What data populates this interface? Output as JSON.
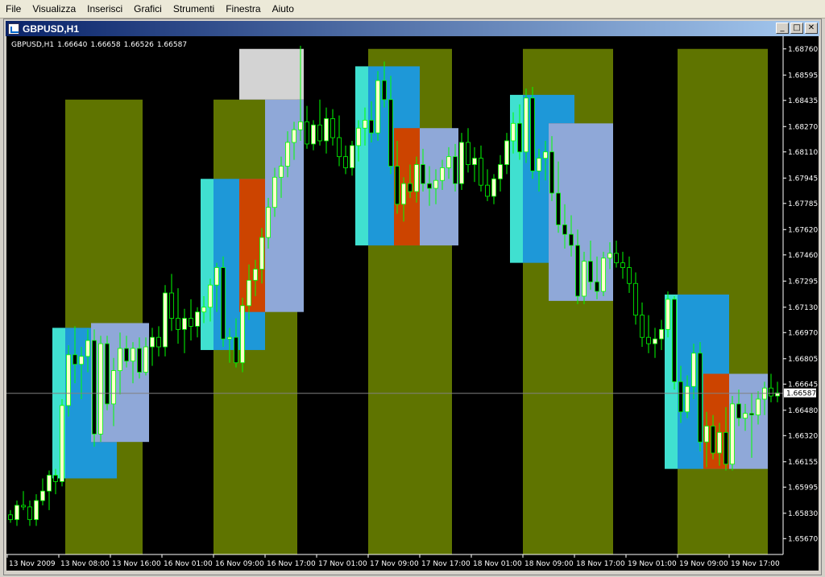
{
  "menu": {
    "items": [
      "File",
      "Visualizza",
      "Inserisci",
      "Grafici",
      "Strumenti",
      "Finestra",
      "Aiuto"
    ]
  },
  "window": {
    "title": "GBPUSD,H1",
    "buttons": {
      "minimize": "_",
      "maximize": "□",
      "close": "✕"
    }
  },
  "chart_info": {
    "symbol": "GBPUSD,H1",
    "open": "1.66640",
    "high": "1.66658",
    "low": "1.66526",
    "close": "1.66587"
  },
  "colors": {
    "background": "#000000",
    "axis_text": "#ffffff",
    "bull_body": "#ffffcc",
    "bear_body": "#000000",
    "candle_outline": "#00ff00",
    "session_band": "#5f7400",
    "zone_cyan": "#40e0d0",
    "zone_blue": "#1e98d8",
    "zone_orange": "#cc4400",
    "zone_light": "#8fa8d8",
    "zone_gray": "#d3d3d3",
    "price_line": "#808080"
  },
  "chart_data": {
    "type": "candlestick",
    "symbol": "GBPUSD",
    "timeframe": "H1",
    "ylim": [
      1.6557,
      1.6884
    ],
    "current_price": "1.66587",
    "y_ticks": [
      "1.68760",
      "1.68595",
      "1.68435",
      "1.68270",
      "1.68110",
      "1.67945",
      "1.67785",
      "1.67620",
      "1.67460",
      "1.67295",
      "1.67130",
      "1.66970",
      "1.66805",
      "1.66645",
      "1.66480",
      "1.66320",
      "1.66155",
      "1.65995",
      "1.65830",
      "1.65670"
    ],
    "x_ticks": [
      {
        "label": "13 Nov 2009",
        "bar": 0
      },
      {
        "label": "13 Nov 08:00",
        "bar": 8
      },
      {
        "label": "13 Nov 16:00",
        "bar": 16
      },
      {
        "label": "16 Nov 01:00",
        "bar": 24
      },
      {
        "label": "16 Nov 09:00",
        "bar": 32
      },
      {
        "label": "16 Nov 17:00",
        "bar": 40
      },
      {
        "label": "17 Nov 01:00",
        "bar": 48
      },
      {
        "label": "17 Nov 09:00",
        "bar": 56
      },
      {
        "label": "17 Nov 17:00",
        "bar": 64
      },
      {
        "label": "18 Nov 01:00",
        "bar": 72
      },
      {
        "label": "18 Nov 09:00",
        "bar": 80
      },
      {
        "label": "18 Nov 17:00",
        "bar": 88
      },
      {
        "label": "19 Nov 01:00",
        "bar": 96
      },
      {
        "label": "19 Nov 09:00",
        "bar": 104
      },
      {
        "label": "19 Nov 17:00",
        "bar": 112
      }
    ],
    "session_bands": [
      {
        "start": 9,
        "end": 21,
        "low": 1.6557,
        "high": 1.6844
      },
      {
        "start": 32,
        "end": 45,
        "low": 1.6557,
        "high": 1.6844
      },
      {
        "start": 56,
        "end": 69,
        "low": 1.6557,
        "high": 1.6876
      },
      {
        "start": 80,
        "end": 94,
        "low": 1.6557,
        "high": 1.6876
      },
      {
        "start": 104,
        "end": 118,
        "low": 1.6557,
        "high": 1.6876
      }
    ],
    "zones": [
      {
        "start": 7,
        "end": 9,
        "low": 1.6605,
        "high": 1.67,
        "color": "zone_cyan"
      },
      {
        "start": 9,
        "end": 17,
        "low": 1.6605,
        "high": 1.67,
        "color": "zone_blue"
      },
      {
        "start": 13,
        "end": 17,
        "low": 1.6628,
        "high": 1.67,
        "color": "zone_orange"
      },
      {
        "start": 13,
        "end": 22,
        "low": 1.6628,
        "high": 1.6703,
        "color": "zone_light"
      },
      {
        "start": 30,
        "end": 32,
        "low": 1.6686,
        "high": 1.6794,
        "color": "zone_cyan"
      },
      {
        "start": 32,
        "end": 40,
        "low": 1.6686,
        "high": 1.6794,
        "color": "zone_blue"
      },
      {
        "start": 36,
        "end": 40,
        "low": 1.671,
        "high": 1.6794,
        "color": "zone_orange"
      },
      {
        "start": 40,
        "end": 46,
        "low": 1.671,
        "high": 1.6844,
        "color": "zone_light"
      },
      {
        "start": 36,
        "end": 46,
        "low": 1.6844,
        "high": 1.6876,
        "color": "zone_gray"
      },
      {
        "start": 54,
        "end": 56,
        "low": 1.6752,
        "high": 1.6865,
        "color": "zone_cyan"
      },
      {
        "start": 56,
        "end": 64,
        "low": 1.6752,
        "high": 1.6865,
        "color": "zone_blue"
      },
      {
        "start": 60,
        "end": 64,
        "low": 1.6752,
        "high": 1.6826,
        "color": "zone_orange"
      },
      {
        "start": 64,
        "end": 70,
        "low": 1.6752,
        "high": 1.6826,
        "color": "zone_light"
      },
      {
        "start": 78,
        "end": 80,
        "low": 1.6741,
        "high": 1.6847,
        "color": "zone_cyan"
      },
      {
        "start": 80,
        "end": 88,
        "low": 1.6741,
        "high": 1.6847,
        "color": "zone_blue"
      },
      {
        "start": 84,
        "end": 88,
        "low": 1.6741,
        "high": 1.6829,
        "color": "zone_orange"
      },
      {
        "start": 84,
        "end": 94,
        "low": 1.6717,
        "high": 1.6829,
        "color": "zone_light"
      },
      {
        "start": 102,
        "end": 104,
        "low": 1.6611,
        "high": 1.6721,
        "color": "zone_cyan"
      },
      {
        "start": 104,
        "end": 112,
        "low": 1.6611,
        "high": 1.6721,
        "color": "zone_blue"
      },
      {
        "start": 108,
        "end": 112,
        "low": 1.6611,
        "high": 1.6671,
        "color": "zone_orange"
      },
      {
        "start": 112,
        "end": 118,
        "low": 1.6611,
        "high": 1.6671,
        "color": "zone_light"
      }
    ],
    "candles": [
      [
        1.6582,
        1.6585,
        1.6577,
        1.6579
      ],
      [
        1.6579,
        1.6591,
        1.6575,
        1.6588
      ],
      [
        1.6588,
        1.6597,
        1.6585,
        1.6587
      ],
      [
        1.6587,
        1.6591,
        1.6575,
        1.6579
      ],
      [
        1.6579,
        1.6595,
        1.6575,
        1.6591
      ],
      [
        1.6591,
        1.6605,
        1.6588,
        1.6597
      ],
      [
        1.6597,
        1.661,
        1.6585,
        1.6607
      ],
      [
        1.6607,
        1.6611,
        1.6595,
        1.6603
      ],
      [
        1.6603,
        1.6655,
        1.66,
        1.6651
      ],
      [
        1.6651,
        1.6689,
        1.6644,
        1.6683
      ],
      [
        1.6683,
        1.6701,
        1.6665,
        1.6677
      ],
      [
        1.6677,
        1.6688,
        1.6655,
        1.6682
      ],
      [
        1.6682,
        1.6699,
        1.6672,
        1.6692
      ],
      [
        1.6692,
        1.6699,
        1.6625,
        1.6633
      ],
      [
        1.6633,
        1.6695,
        1.6628,
        1.669
      ],
      [
        1.669,
        1.6695,
        1.6648,
        1.6652
      ],
      [
        1.6652,
        1.6681,
        1.6638,
        1.6673
      ],
      [
        1.6673,
        1.6697,
        1.6658,
        1.6687
      ],
      [
        1.6687,
        1.6695,
        1.6675,
        1.6679
      ],
      [
        1.6679,
        1.6691,
        1.6665,
        1.6687
      ],
      [
        1.6687,
        1.6694,
        1.6668,
        1.6672
      ],
      [
        1.6672,
        1.6694,
        1.667,
        1.6688
      ],
      [
        1.6688,
        1.67,
        1.6676,
        1.6694
      ],
      [
        1.6694,
        1.6701,
        1.6682,
        1.6688
      ],
      [
        1.6688,
        1.6727,
        1.6682,
        1.6722
      ],
      [
        1.6722,
        1.6734,
        1.6698,
        1.6706
      ],
      [
        1.6706,
        1.6725,
        1.669,
        1.6699
      ],
      [
        1.6699,
        1.6712,
        1.6684,
        1.6706
      ],
      [
        1.6706,
        1.6718,
        1.6692,
        1.6701
      ],
      [
        1.6701,
        1.6713,
        1.6694,
        1.671
      ],
      [
        1.671,
        1.672,
        1.6703,
        1.6713
      ],
      [
        1.6713,
        1.6731,
        1.6704,
        1.6727
      ],
      [
        1.6727,
        1.6741,
        1.671,
        1.6738
      ],
      [
        1.6738,
        1.6745,
        1.6688,
        1.6693
      ],
      [
        1.6693,
        1.67,
        1.6678,
        1.6694
      ],
      [
        1.6694,
        1.6706,
        1.6675,
        1.6678
      ],
      [
        1.6678,
        1.6719,
        1.6672,
        1.6714
      ],
      [
        1.6714,
        1.674,
        1.6705,
        1.673
      ],
      [
        1.673,
        1.6743,
        1.672,
        1.6737
      ],
      [
        1.6737,
        1.6763,
        1.6728,
        1.6757
      ],
      [
        1.6757,
        1.6782,
        1.675,
        1.6776
      ],
      [
        1.6776,
        1.6801,
        1.677,
        1.6795
      ],
      [
        1.6795,
        1.6808,
        1.6782,
        1.6802
      ],
      [
        1.6802,
        1.6824,
        1.6795,
        1.6817
      ],
      [
        1.6817,
        1.683,
        1.6806,
        1.6825
      ],
      [
        1.6825,
        1.6878,
        1.6818,
        1.683
      ],
      [
        1.683,
        1.684,
        1.6813,
        1.6816
      ],
      [
        1.6816,
        1.6831,
        1.6812,
        1.6828
      ],
      [
        1.6828,
        1.6844,
        1.6815,
        1.6818
      ],
      [
        1.6818,
        1.6839,
        1.681,
        1.6832
      ],
      [
        1.6832,
        1.6838,
        1.6815,
        1.682
      ],
      [
        1.682,
        1.6834,
        1.6802,
        1.6808
      ],
      [
        1.6808,
        1.6815,
        1.6797,
        1.6801
      ],
      [
        1.6801,
        1.6818,
        1.6796,
        1.6815
      ],
      [
        1.6815,
        1.6831,
        1.6805,
        1.6826
      ],
      [
        1.6826,
        1.6839,
        1.6815,
        1.6831
      ],
      [
        1.6831,
        1.6843,
        1.6817,
        1.6823
      ],
      [
        1.6823,
        1.6862,
        1.6818,
        1.6856
      ],
      [
        1.6856,
        1.6868,
        1.6839,
        1.6844
      ],
      [
        1.6844,
        1.6859,
        1.6797,
        1.6802
      ],
      [
        1.6802,
        1.6818,
        1.6772,
        1.6778
      ],
      [
        1.6778,
        1.6795,
        1.6767,
        1.6791
      ],
      [
        1.6791,
        1.6803,
        1.6782,
        1.6786
      ],
      [
        1.6786,
        1.6808,
        1.6779,
        1.6803
      ],
      [
        1.6803,
        1.6813,
        1.6786,
        1.6791
      ],
      [
        1.6791,
        1.6802,
        1.6777,
        1.6788
      ],
      [
        1.6788,
        1.68,
        1.6778,
        1.6793
      ],
      [
        1.6793,
        1.6806,
        1.6787,
        1.6801
      ],
      [
        1.6801,
        1.6814,
        1.6794,
        1.6808
      ],
      [
        1.6808,
        1.6816,
        1.6786,
        1.6791
      ],
      [
        1.6791,
        1.6823,
        1.6787,
        1.6817
      ],
      [
        1.6817,
        1.6826,
        1.6798,
        1.6803
      ],
      [
        1.6803,
        1.6814,
        1.6792,
        1.6807
      ],
      [
        1.6807,
        1.6815,
        1.6786,
        1.679
      ],
      [
        1.679,
        1.68,
        1.678,
        1.6783
      ],
      [
        1.6783,
        1.6797,
        1.6778,
        1.6794
      ],
      [
        1.6794,
        1.6809,
        1.6786,
        1.6803
      ],
      [
        1.6803,
        1.6823,
        1.6797,
        1.6818
      ],
      [
        1.6818,
        1.6836,
        1.681,
        1.6829
      ],
      [
        1.6829,
        1.6841,
        1.6806,
        1.6811
      ],
      [
        1.6811,
        1.6851,
        1.6804,
        1.6845
      ],
      [
        1.6845,
        1.6852,
        1.6794,
        1.6799
      ],
      [
        1.6799,
        1.6813,
        1.6786,
        1.6807
      ],
      [
        1.6807,
        1.6818,
        1.6793,
        1.6811
      ],
      [
        1.6811,
        1.6821,
        1.678,
        1.6785
      ],
      [
        1.6785,
        1.6805,
        1.676,
        1.6765
      ],
      [
        1.6765,
        1.6778,
        1.675,
        1.6759
      ],
      [
        1.6759,
        1.6771,
        1.6745,
        1.6752
      ],
      [
        1.6752,
        1.6762,
        1.6715,
        1.672
      ],
      [
        1.672,
        1.6748,
        1.6715,
        1.6742
      ],
      [
        1.6742,
        1.6755,
        1.6724,
        1.6729
      ],
      [
        1.6729,
        1.6745,
        1.6718,
        1.6723
      ],
      [
        1.6723,
        1.6748,
        1.672,
        1.6744
      ],
      [
        1.6744,
        1.6754,
        1.6737,
        1.6747
      ],
      [
        1.6747,
        1.6755,
        1.6738,
        1.6741
      ],
      [
        1.6741,
        1.6748,
        1.6731,
        1.6738
      ],
      [
        1.6738,
        1.6745,
        1.6722,
        1.6728
      ],
      [
        1.6728,
        1.6735,
        1.6702,
        1.6708
      ],
      [
        1.6708,
        1.6716,
        1.6688,
        1.6694
      ],
      [
        1.6694,
        1.6708,
        1.6684,
        1.669
      ],
      [
        1.669,
        1.67,
        1.6681,
        1.6693
      ],
      [
        1.6693,
        1.6705,
        1.6686,
        1.6699
      ],
      [
        1.6699,
        1.6723,
        1.6694,
        1.6718
      ],
      [
        1.6718,
        1.672,
        1.6661,
        1.6666
      ],
      [
        1.6666,
        1.6676,
        1.664,
        1.6647
      ],
      [
        1.6647,
        1.667,
        1.6643,
        1.6663
      ],
      [
        1.6663,
        1.669,
        1.6655,
        1.6684
      ],
      [
        1.6684,
        1.6691,
        1.6622,
        1.6628
      ],
      [
        1.6628,
        1.6647,
        1.6612,
        1.6638
      ],
      [
        1.6638,
        1.6645,
        1.6617,
        1.6621
      ],
      [
        1.6621,
        1.664,
        1.6613,
        1.6634
      ],
      [
        1.6634,
        1.665,
        1.661,
        1.6614
      ],
      [
        1.6614,
        1.6657,
        1.661,
        1.6652
      ],
      [
        1.6652,
        1.6661,
        1.6638,
        1.6643
      ],
      [
        1.6643,
        1.6652,
        1.6635,
        1.6646
      ],
      [
        1.6646,
        1.6659,
        1.6618,
        1.6645
      ],
      [
        1.6645,
        1.666,
        1.6639,
        1.6655
      ],
      [
        1.6655,
        1.6666,
        1.6645,
        1.6662
      ],
      [
        1.6662,
        1.6671,
        1.6653,
        1.6657
      ],
      [
        1.6657,
        1.6666,
        1.6653,
        1.6659
      ]
    ]
  }
}
